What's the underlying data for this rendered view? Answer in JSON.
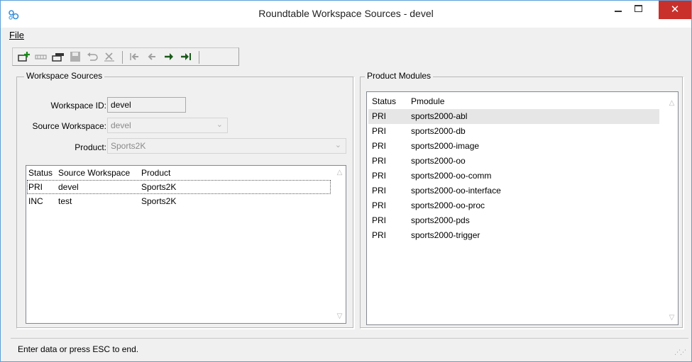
{
  "window": {
    "title": "Roundtable Workspace Sources - devel",
    "minimize_icon": "minimize-icon",
    "maximize_icon": "maximize-icon",
    "close_icon": "close-icon",
    "close_glyph": "✕",
    "close_color": "#c9302c",
    "app_icon": "gear-cluster-icon"
  },
  "menubar": {
    "file_label": "File"
  },
  "toolbar": {
    "buttons": [
      {
        "icon": "add-record-icon"
      },
      {
        "icon": "copy-record-icon"
      },
      {
        "icon": "edit-record-icon"
      },
      {
        "icon": "save-icon"
      },
      {
        "icon": "undo-icon"
      },
      {
        "icon": "delete-icon"
      },
      {
        "icon": "first-record-icon"
      },
      {
        "icon": "previous-record-icon"
      },
      {
        "icon": "next-record-icon"
      },
      {
        "icon": "last-record-icon"
      }
    ]
  },
  "workspace_sources": {
    "group_label": "Workspace Sources",
    "workspace_id_label": "Workspace ID:",
    "workspace_id_value": "devel",
    "source_workspace_label": "Source Workspace:",
    "source_workspace_value": "devel",
    "product_label": "Product:",
    "product_value": "Sports2K",
    "columns": [
      "Status",
      "Source Workspace",
      "Product"
    ],
    "rows": [
      {
        "status": "PRI",
        "source": "devel",
        "product": "Sports2K",
        "selected": true
      },
      {
        "status": "INC",
        "source": "test",
        "product": "Sports2K",
        "selected": false
      }
    ]
  },
  "product_modules": {
    "group_label": "Product Modules",
    "columns": [
      "Status",
      "Pmodule"
    ],
    "rows": [
      {
        "status": "PRI",
        "pmodule": "sports2000-abl"
      },
      {
        "status": "PRI",
        "pmodule": "sports2000-db"
      },
      {
        "status": "PRI",
        "pmodule": "sports2000-image"
      },
      {
        "status": "PRI",
        "pmodule": "sports2000-oo"
      },
      {
        "status": "PRI",
        "pmodule": "sports2000-oo-comm"
      },
      {
        "status": "PRI",
        "pmodule": "sports2000-oo-interface"
      },
      {
        "status": "PRI",
        "pmodule": "sports2000-oo-proc"
      },
      {
        "status": "PRI",
        "pmodule": "sports2000-pds"
      },
      {
        "status": "PRI",
        "pmodule": "sports2000-trigger"
      }
    ]
  },
  "statusbar": {
    "text": "Enter data or press ESC to end."
  }
}
